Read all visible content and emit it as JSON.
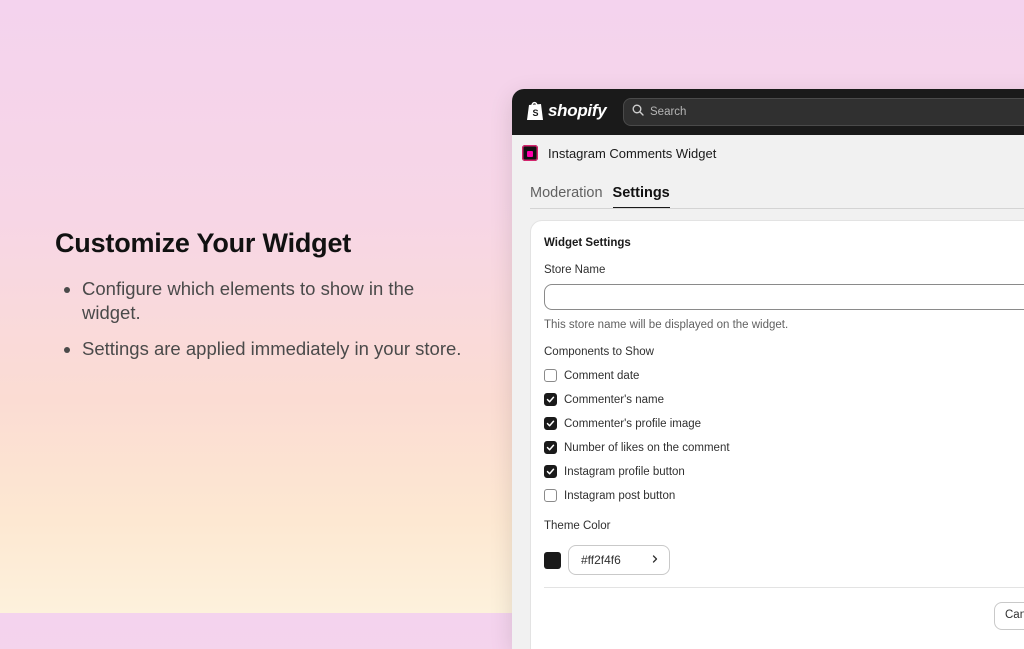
{
  "promo": {
    "heading": "Customize Your Widget",
    "bullets": [
      "Configure which elements to show in the widget.",
      "Settings are applied immediately in your store."
    ]
  },
  "admin": {
    "logo_text": "shopify",
    "search_placeholder": "Search",
    "app_name": "Instagram Comments Widget",
    "tabs": [
      {
        "label": "Moderation",
        "active": false
      },
      {
        "label": "Settings",
        "active": true
      }
    ]
  },
  "settings": {
    "card_title": "Widget Settings",
    "store_name_label": "Store Name",
    "store_name_value": "",
    "store_name_help": "This store name will be displayed on the widget.",
    "components_label": "Components to Show",
    "components": [
      {
        "label": "Comment date",
        "checked": false
      },
      {
        "label": "Commenter's name",
        "checked": true
      },
      {
        "label": "Commenter's profile image",
        "checked": true
      },
      {
        "label": "Number of likes on the comment",
        "checked": true
      },
      {
        "label": "Instagram profile button",
        "checked": true
      },
      {
        "label": "Instagram post button",
        "checked": false
      }
    ],
    "theme_color_label": "Theme Color",
    "theme_color_value": "#ff2f4f6",
    "cancel_label": "Can"
  },
  "colors": {
    "topbar": "#1a1a1a",
    "checkbox_checked": "#1a1a1a",
    "theme_swatch": "#1a1a1a"
  }
}
